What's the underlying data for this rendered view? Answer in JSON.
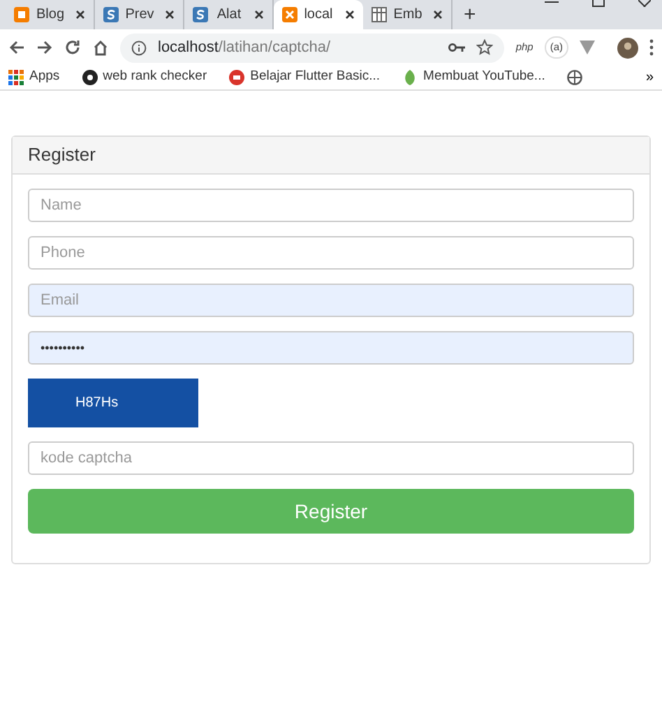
{
  "tabs": [
    {
      "label": "Blog",
      "selected": false
    },
    {
      "label": "Prev",
      "selected": false
    },
    {
      "label": "Alat",
      "selected": false
    },
    {
      "label": "local",
      "selected": true
    },
    {
      "label": "Emb",
      "selected": false
    }
  ],
  "new_tab": "+",
  "address": {
    "host": "localhost",
    "path": "/latihan/captcha/"
  },
  "extensions": [
    "php",
    "(a)"
  ],
  "bookmarks": [
    {
      "label": "Apps"
    },
    {
      "label": "web rank checker"
    },
    {
      "label": "Belajar Flutter Basic..."
    },
    {
      "label": "Membuat YouTube..."
    }
  ],
  "bookmarks_more": "»",
  "card": {
    "title": "Register",
    "fields": [
      {
        "kind": "input",
        "placeholder": "Name",
        "autofilled": false
      },
      {
        "kind": "input",
        "placeholder": "Phone",
        "autofilled": false
      },
      {
        "kind": "input",
        "placeholder": "Email",
        "autofilled": true
      },
      {
        "kind": "input",
        "value": "••••••••••",
        "autofilled": true
      },
      {
        "kind": "captcha",
        "text": "H87Hs"
      },
      {
        "kind": "input",
        "placeholder": "kode captcha",
        "autofilled": false
      }
    ],
    "button": "Register"
  }
}
